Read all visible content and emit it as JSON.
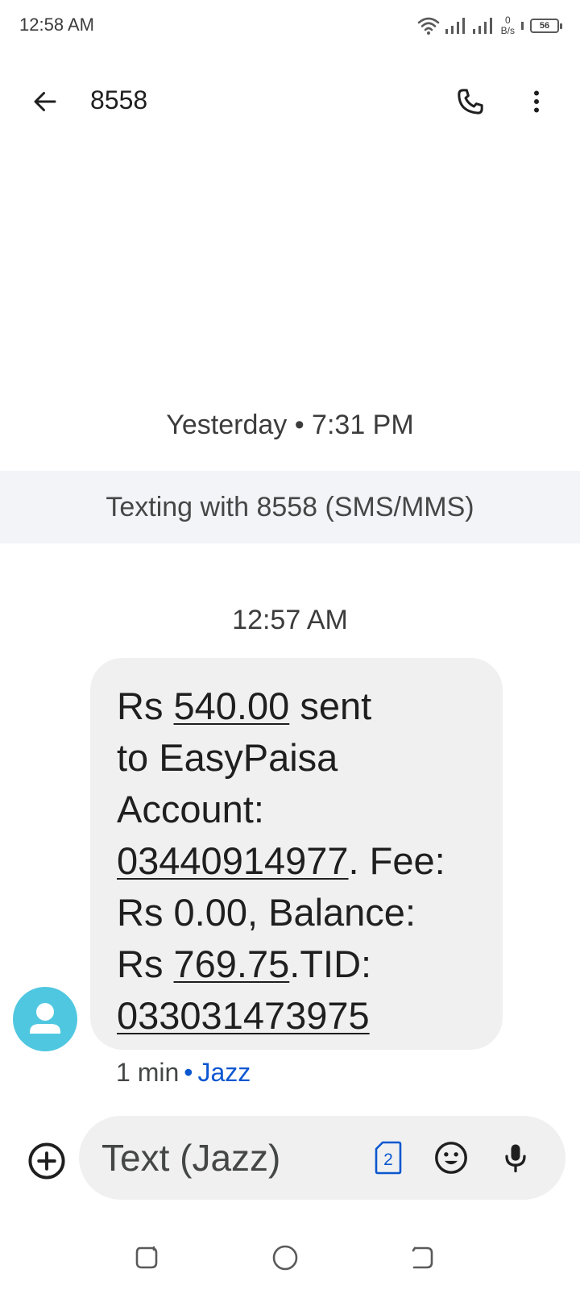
{
  "status_bar": {
    "time": "12:58 AM",
    "net_speed_value": "0",
    "net_speed_unit": "B/s",
    "battery_level": "56",
    "icons": [
      "wifi-icon",
      "signal-icon",
      "signal-icon",
      "battery-icon"
    ]
  },
  "app_bar": {
    "title": "8558",
    "icons": [
      "back-arrow-icon",
      "phone-icon",
      "more-vert-icon"
    ]
  },
  "conversation": {
    "date_stamp": "Yesterday • 7:31 PM",
    "texting_banner": "Texting with 8558 (SMS/MMS)",
    "time_stamp": "12:57 AM"
  },
  "message": {
    "segments": [
      {
        "text": "Rs ",
        "underline": false
      },
      {
        "text": "540.00",
        "underline": true
      },
      {
        "text": " sent\nto EasyPaisa\nAccount:\n",
        "underline": false
      },
      {
        "text": "03440914977",
        "underline": true
      },
      {
        "text": ". Fee:\nRs 0.00, Balance:\nRs ",
        "underline": false
      },
      {
        "text": "769.75",
        "underline": true
      },
      {
        "text": ".TID:\n",
        "underline": false
      },
      {
        "text": "033031473975",
        "underline": true
      }
    ],
    "age": "1 min",
    "separator": "•",
    "carrier": "Jazz"
  },
  "compose": {
    "placeholder": "Text (Jazz)",
    "sim_label": "2",
    "icons": [
      "add-circle-icon",
      "sim-card-icon",
      "emoji-icon",
      "mic-icon"
    ]
  },
  "nav_bar": {
    "icons": [
      "recent-apps-icon",
      "home-icon",
      "back-icon"
    ]
  },
  "colors": {
    "accent": "#0b57d0",
    "avatar": "#4fc7e0",
    "bubble": "#f0f0f0",
    "banner": "#f2f4f8"
  }
}
